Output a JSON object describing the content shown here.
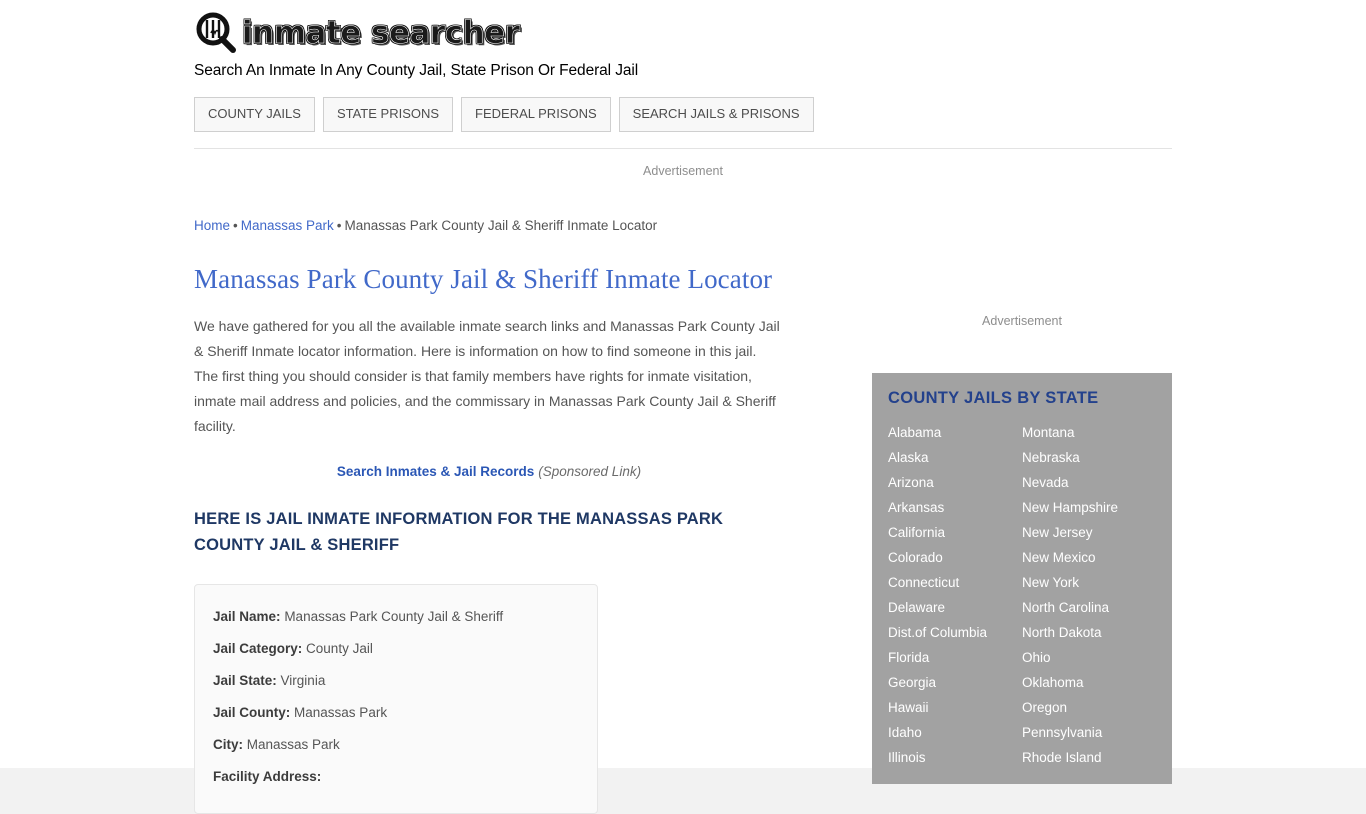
{
  "site": {
    "logo_text": "inmate searcher",
    "logo_icon": "magnifier-prison-bars-icon",
    "tagline": "Search An Inmate In Any County Jail, State Prison Or Federal Jail"
  },
  "nav": {
    "items": [
      {
        "label": "COUNTY JAILS"
      },
      {
        "label": "STATE PRISONS"
      },
      {
        "label": "FEDERAL PRISONS"
      },
      {
        "label": "SEARCH JAILS & PRISONS"
      }
    ]
  },
  "ads": {
    "top_label": "Advertisement",
    "side_label": "Advertisement"
  },
  "breadcrumb": {
    "home": "Home",
    "sep1": "•",
    "county": "Manassas Park",
    "sep2": "•",
    "current": "Manassas Park County Jail & Sheriff Inmate Locator"
  },
  "main": {
    "title": "Manassas Park County Jail & Sheriff Inmate Locator",
    "intro": "We have gathered for you all the available inmate search links and Manassas Park County Jail & Sheriff Inmate locator information. Here is information on how to find someone in this jail. The first thing you should consider is that family members have rights for inmate visitation, inmate mail address and policies, and the commissary in Manassas Park County Jail & Sheriff facility.",
    "sponsor_link": "Search Inmates & Jail Records",
    "sponsor_note": "(Sponsored Link)",
    "section_heading": "HERE IS JAIL INMATE INFORMATION FOR THE MANASSAS PARK COUNTY JAIL & SHERIFF"
  },
  "info_box": {
    "rows": [
      {
        "label": "Jail Name:",
        "value": "Manassas Park County Jail & Sheriff"
      },
      {
        "label": "Jail Category:",
        "value": "County Jail"
      },
      {
        "label": "Jail State:",
        "value": "Virginia"
      },
      {
        "label": "Jail County:",
        "value": "Manassas Park"
      },
      {
        "label": "City:",
        "value": "Manassas Park"
      },
      {
        "label": "Facility Address:",
        "value": ""
      }
    ]
  },
  "sidebar": {
    "title": "COUNTY JAILS BY STATE",
    "left_column": [
      "Alabama",
      "Alaska",
      "Arizona",
      "Arkansas",
      "California",
      "Colorado",
      "Connecticut",
      "Delaware",
      "Dist.of Columbia",
      "Florida",
      "Georgia",
      "Hawaii",
      "Idaho",
      "Illinois"
    ],
    "right_column": [
      "Montana",
      "Nebraska",
      "Nevada",
      "New Hampshire",
      "New Jersey",
      "New Mexico",
      "New York",
      "North Carolina",
      "North Dakota",
      "Ohio",
      "Oklahoma",
      "Oregon",
      "Pennsylvania",
      "Rhode Island"
    ]
  },
  "colors": {
    "link_blue": "#4169c9",
    "heading_navy": "#1f3864",
    "sidebar_bg": "#a2a2a2",
    "sidebar_title": "#23418c",
    "body_text": "#555555"
  }
}
